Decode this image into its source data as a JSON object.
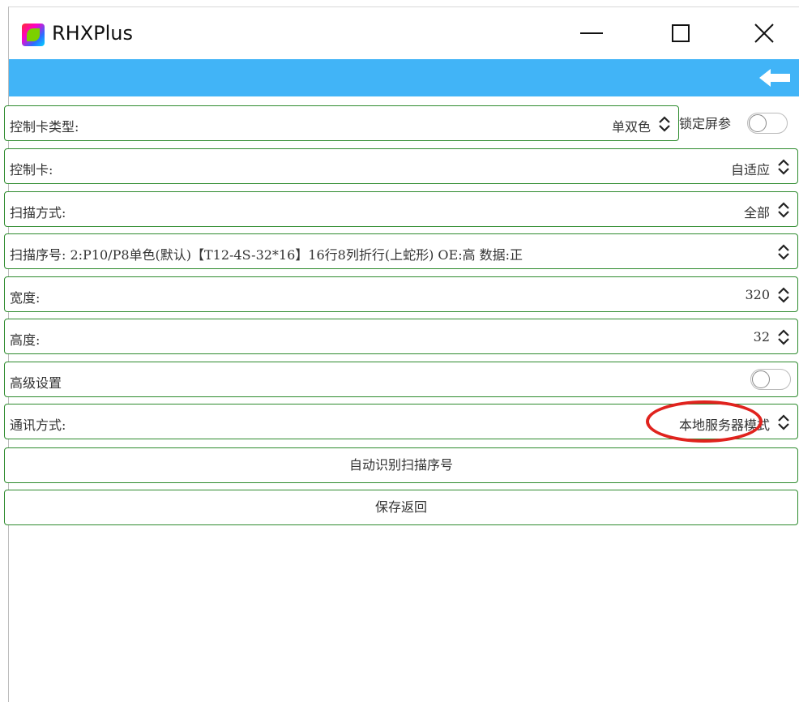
{
  "window": {
    "title": "RHXPlus"
  },
  "icons": {
    "app": "app-logo-icon",
    "minimize": "minimize-icon",
    "maximize": "maximize-icon",
    "close": "close-icon",
    "back": "back-arrow-icon",
    "chevron": "up-down-chevron-icon"
  },
  "colors": {
    "accent_bar": "#41b4f7",
    "row_border": "#2e8b2e",
    "annotation": "#e0231e"
  },
  "form": {
    "card_type": {
      "label": "控制卡类型:",
      "value": "单双色"
    },
    "lock_screen": {
      "label": "锁定屏参",
      "on": false
    },
    "card": {
      "label": "控制卡:",
      "value": "自适应"
    },
    "scan_mode": {
      "label": "扫描方式:",
      "value": "全部"
    },
    "scan_seq": {
      "label": "扫描序号:  2:P10/P8单色(默认)【T12-4S-32*16】16行8列折行(上蛇形) OE:高 数据:正"
    },
    "width": {
      "label": "宽度:",
      "value": "320"
    },
    "height": {
      "label": "高度:",
      "value": "32"
    },
    "advanced": {
      "label": "高级设置",
      "on": false
    },
    "comm": {
      "label": "通讯方式:",
      "value": "本地服务器模式"
    }
  },
  "buttons": {
    "auto_detect": "自动识别扫描序号",
    "save": "保存返回"
  }
}
